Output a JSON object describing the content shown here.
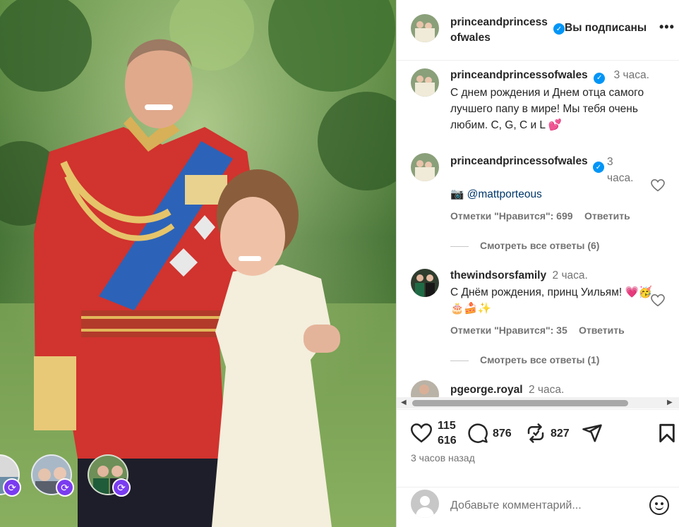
{
  "post": {
    "account": "princeandprincessofwales",
    "follow_status": "Вы подписаны",
    "more_label": "•••"
  },
  "caption": {
    "username": "princeandprincessofwales",
    "time": "3 часа.",
    "text": "С днем рождения и Днем отца самого лучшего папу в мире! Мы тебя очень любим. C, G, C и L 💕"
  },
  "comments": [
    {
      "username": "princeandprincessofwales",
      "time": "3 часа.",
      "text_prefix": "📷 ",
      "mention": "@mattporteous",
      "likes": "Отметки \"Нравится\": 699",
      "reply": "Ответить",
      "view_replies": "Смотреть все ответы (6)"
    },
    {
      "username": "thewindsorsfamily",
      "time": "2 часа.",
      "text": "С Днём рождения, принц Уильям! 💗🥳🎂🍰✨",
      "likes": "Отметки \"Нравится\": 35",
      "reply": "Ответить",
      "view_replies": "Смотреть все ответы (1)"
    },
    {
      "username": "pgeorge.royal",
      "time": "2 часа."
    }
  ],
  "actions": {
    "likes": "115 616",
    "likes_line1": "115",
    "likes_line2": "616",
    "comments": "876",
    "reposts": "827",
    "time_ago": "3 часов назад"
  },
  "add_comment": {
    "placeholder": "Добавьте комментарий..."
  },
  "icons": {
    "verified": "verified-badge-icon",
    "like": "heart-icon",
    "comment": "comment-bubble-icon",
    "repost": "repost-icon",
    "share": "paper-plane-icon",
    "save": "bookmark-icon",
    "emoji": "smiley-icon",
    "collab": "collab-refresh-icon"
  },
  "colors": {
    "verified": "#0095f6",
    "link": "#00376b",
    "secondary_text": "#737373",
    "collab_badge": "#7a3cf0"
  }
}
